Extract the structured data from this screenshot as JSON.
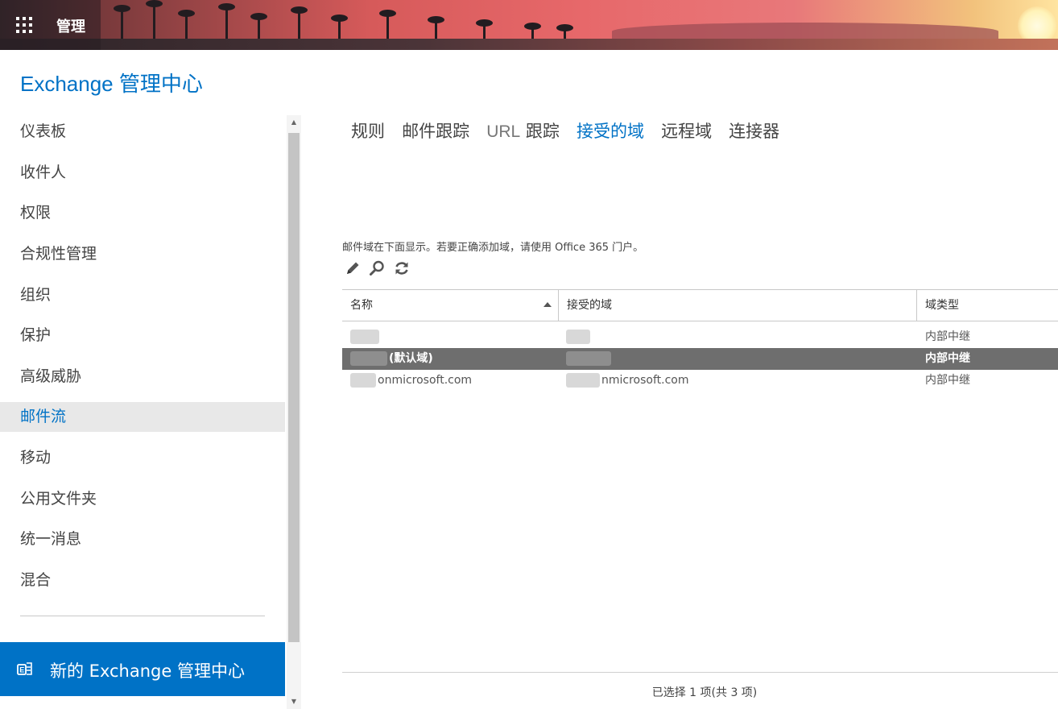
{
  "topbar": {
    "title": "管理",
    "waffle_icon": "app-launcher-icon"
  },
  "app_title": "Exchange 管理中心",
  "sidebar": {
    "items": [
      {
        "label": "仪表板"
      },
      {
        "label": "收件人"
      },
      {
        "label": "权限"
      },
      {
        "label": "合规性管理"
      },
      {
        "label": "组织"
      },
      {
        "label": "保护"
      },
      {
        "label": "高级威胁"
      },
      {
        "label": "邮件流",
        "selected": true
      },
      {
        "label": "移动"
      },
      {
        "label": "公用文件夹"
      },
      {
        "label": "统一消息"
      },
      {
        "label": "混合"
      }
    ],
    "new_eac": {
      "label": "新的 Exchange 管理中心",
      "icon": "exchange-icon"
    }
  },
  "tabs": {
    "rules": "规则",
    "message_trace": "邮件跟踪",
    "url_trace_prefix": "URL",
    "url_trace_suffix": "跟踪",
    "accepted_domains": "接受的域",
    "remote_domains": "远程域",
    "connectors": "连接器"
  },
  "description": "邮件域在下面显示。若要正确添加域，请使用 Office 365 门户。",
  "toolbar": {
    "edit_icon": "pencil-icon",
    "search_icon": "search-icon",
    "refresh_icon": "refresh-icon"
  },
  "table": {
    "columns": {
      "name": "名称",
      "accepted_domain": "接受的域",
      "domain_type": "域类型"
    },
    "rows": [
      {
        "name": "",
        "accepted_domain": "",
        "domain_type": "内部中继",
        "selected": false
      },
      {
        "name": "(默认域)",
        "accepted_domain": "",
        "domain_type": "内部中继",
        "selected": true
      },
      {
        "name": "onmicrosoft.com",
        "accepted_domain": "nmicrosoft.com",
        "domain_type": "内部中继",
        "selected": false
      }
    ]
  },
  "status": "已选择 1 项(共 3 项)",
  "colors": {
    "accent": "#0072c6",
    "selected_row": "#6e6e6e",
    "nav_selected_bg": "#e8e8e8"
  }
}
